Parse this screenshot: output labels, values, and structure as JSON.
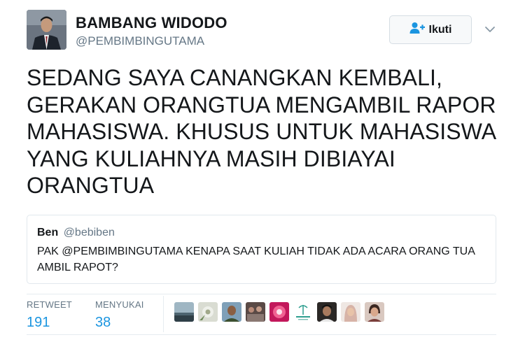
{
  "author": {
    "display_name": "BAMBANG WIDODO",
    "username": "@PEMBIMBINGUTAMA",
    "avatar_icon": "profile-photo"
  },
  "follow_button": {
    "label": "Ikuti",
    "icon": "add-user-icon",
    "color": "#1b95e0"
  },
  "tweet": {
    "text": "SEDANG SAYA CANANGKAN KEMBALI, GERAKAN ORANGTUA MENGAMBIL RAPOR MAHASISWA. KHUSUS UNTUK MAHASISWA YANG KULIAHNYA MASIH DIBIAYAI ORANGTUA"
  },
  "quoted_tweet": {
    "name": "Ben",
    "username": "@bebiben",
    "text": "PAK @PEMBIMBINGUTAMA KENAPA SAAT KULIAH TIDAK ADA ACARA ORANG TUA AMBIL RAPOT?"
  },
  "stats": {
    "retweet_label": "RETWEET",
    "retweet_count": "191",
    "likes_label": "MENYUKAI",
    "likes_count": "38"
  },
  "likers": [
    {
      "icon": "landscape-avatar",
      "color": "#5f7c8a"
    },
    {
      "icon": "flower-avatar",
      "color": "#a9b39a"
    },
    {
      "icon": "person-avatar",
      "color": "#7b5e45"
    },
    {
      "icon": "group-avatar",
      "color": "#6e5a55"
    },
    {
      "icon": "pink-avatar",
      "color": "#d6336c"
    },
    {
      "icon": "logo-avatar",
      "color": "#2e9e8f"
    },
    {
      "icon": "person-avatar",
      "color": "#3e3a38"
    },
    {
      "icon": "hijab-avatar",
      "color": "#c9a9a0"
    },
    {
      "icon": "person-avatar",
      "color": "#8c6a5a"
    }
  ]
}
